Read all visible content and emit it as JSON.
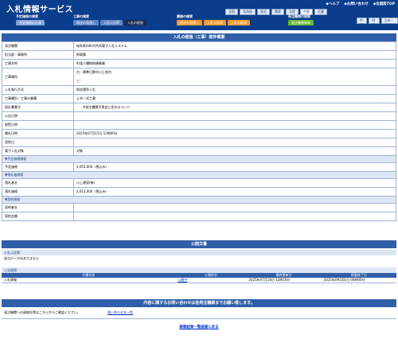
{
  "header": {
    "title": "入札情報サービス",
    "links": [
      "◆ヘルプ",
      "◆お問い合わせ",
      "◆全国版TOP"
    ],
    "regions_row1": [
      "全国",
      "北海道",
      "東北",
      "関東",
      "北陸",
      "中部",
      "近畿",
      "中国",
      "四国",
      "九州・沖縄"
    ],
    "regions_row2": [],
    "mode_labels": [
      "予定価格の検索",
      "工事の検索",
      "業務の検索",
      "発注機関の検索"
    ],
    "tabs": {
      "g1": [
        "予定価格の公表"
      ],
      "g2": [
        "発注の見通し",
        "入札公告等",
        "入札の経過"
      ],
      "g3": [
        "発注の見通し",
        "入札公告等",
        "入札の経過"
      ],
      "g4": [
        "発注機関情報"
      ]
    }
  },
  "detail": {
    "heading": "入札の経過（工事）案件概要",
    "rows": [
      {
        "label": "発注機関",
        "value": "岐阜県市町村共同電子入札システム"
      },
      {
        "label": "担当部・事務所",
        "value": "財政課"
      },
      {
        "label": "工事名称",
        "value": "町道八幡線修繕事業"
      },
      {
        "label": "工事場所",
        "value": "白・標準日野市川上地内",
        "value2": "三："
      },
      {
        "label": "入札執行方式",
        "value": "指名競争入札"
      },
      {
        "label": "工事種別／工事の業種",
        "value": "土木一式工事"
      },
      {
        "label": "設計書番号",
        "value": "　　※発注機関が独自に定めるコード"
      },
      {
        "label": "公告日時",
        "value": ""
      },
      {
        "label": "縦覧日時",
        "value": ""
      },
      {
        "label": "開札日時",
        "value": "2025年07月15日 12時00分"
      },
      {
        "label": "契約日",
        "value": ""
      },
      {
        "label": "電子入札対象",
        "value": "対象"
      }
    ],
    "group_price": "▼予定価格情報",
    "price_rows": [
      {
        "label": "予定価格",
        "value": "2,055,000（税込み）"
      }
    ],
    "group_award": "▼落札者情報",
    "award_rows": [
      {
        "label": "落札者名",
        "value": "川上建設(株)"
      },
      {
        "label": "落札価格",
        "value": "2,013,000（税込み）"
      }
    ],
    "group_contract": "▼契約情報",
    "contract_rows": [
      {
        "label": "契約者名",
        "value": ""
      },
      {
        "label": "契約金額",
        "value": ""
      }
    ]
  },
  "public_docs": {
    "heading": "公開文書",
    "notice_head": "入札公告等",
    "notice_empty": "該当データはありません",
    "result_head": "入札経過",
    "columns": [
      "文書名称",
      "公開状況",
      "最終更新日",
      "掲載終了日"
    ],
    "row": [
      "入札情報",
      "公開中",
      "2025年07月16日 12時10分",
      "2025年09月01日 00時00分"
    ]
  },
  "contact": {
    "heading": "内容に関するお問い合わせは各発注機関までお願い致します。",
    "text": "発注機関への連絡先等はこちらからご確認ください。",
    "link": "問い合わせ先一覧"
  },
  "back_link": "検索結果一覧画面に戻る"
}
